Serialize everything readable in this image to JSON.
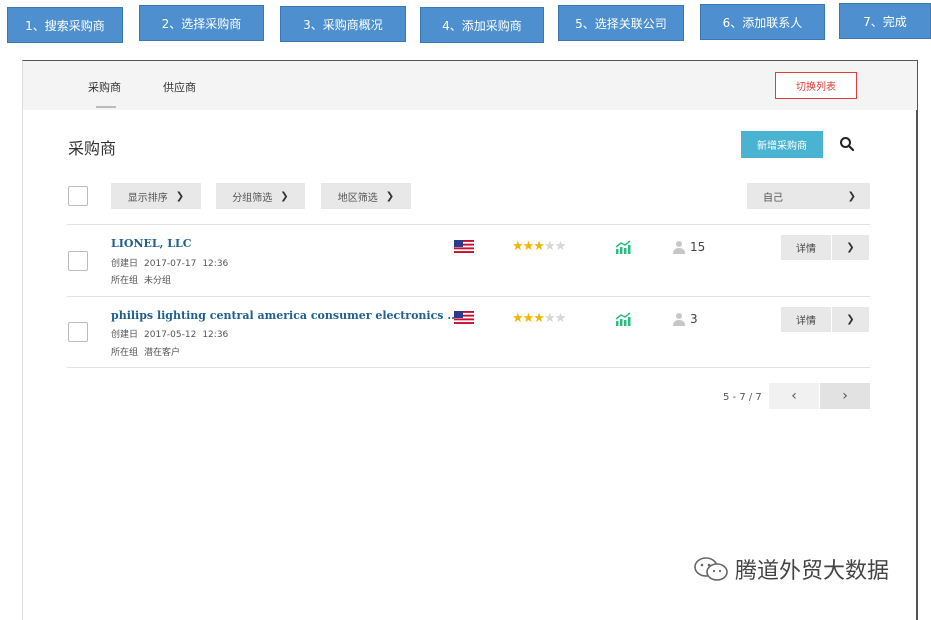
{
  "steps": [
    "1、搜索采购商",
    "2、选择采购商",
    "3、采购商概况",
    "4、添加采购商",
    "5、选择关联公司",
    "6、添加联系人",
    "7、完成"
  ],
  "tabs": {
    "buyers": "采购商",
    "suppliers": "供应商"
  },
  "switch_label": "切换列表",
  "page_title": "采购商",
  "new_button": "新增采购商",
  "filters": {
    "sort": "显示排序",
    "group": "分组筛选",
    "region": "地区筛选",
    "owner": "自己"
  },
  "rows": [
    {
      "company": "LIONEL, LLC",
      "created_label": "创建日",
      "created_date": "2017-07-17",
      "created_time": "12:36",
      "group_label": "所在组",
      "group": "未分组",
      "stars": 3,
      "contacts": "15",
      "detail": "详情"
    },
    {
      "company": "philips lighting central america consumer electronics ...",
      "created_label": "创建日",
      "created_date": "2017-05-12",
      "created_time": "12:36",
      "group_label": "所在组",
      "group": "潜在客户",
      "stars": 3,
      "contacts": "3",
      "detail": "详情"
    }
  ],
  "pagination": {
    "text": "5 - 7 / 7"
  },
  "watermark": "腾道外贸大数据",
  "colors": {
    "step_bg": "#4d8fcf",
    "accent": "#4ab3d1",
    "switch": "#e23b3b",
    "link": "#1f5f8f",
    "star": "#f4b400",
    "trend": "#2bbd7e"
  }
}
